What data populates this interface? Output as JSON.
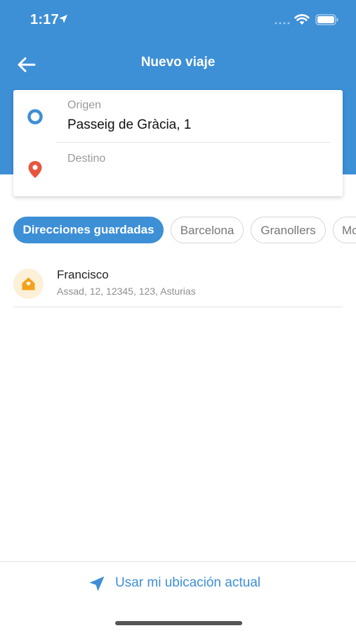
{
  "status_bar": {
    "time": "1:17"
  },
  "header": {
    "title": "Nuevo viaje"
  },
  "route": {
    "origin_label": "Origen",
    "origin_value": "Passeig de Gràcia, 1",
    "destination_label": "Destino",
    "destination_value": ""
  },
  "filters": [
    {
      "label": "Direcciones guardadas",
      "active": true
    },
    {
      "label": "Barcelona",
      "active": false
    },
    {
      "label": "Granollers",
      "active": false
    },
    {
      "label": "Mo",
      "active": false
    }
  ],
  "saved_addresses": [
    {
      "name": "Francisco",
      "address": "Assad, 12, 12345, 123, Asturias",
      "icon": "home-icon"
    }
  ],
  "footer": {
    "use_location_label": "Usar mi ubicación actual"
  },
  "colors": {
    "primary": "#3d8fd6",
    "destination_pin": "#e8553f",
    "home_icon": "#f3a21b",
    "home_badge_bg": "#fdf0d8"
  }
}
